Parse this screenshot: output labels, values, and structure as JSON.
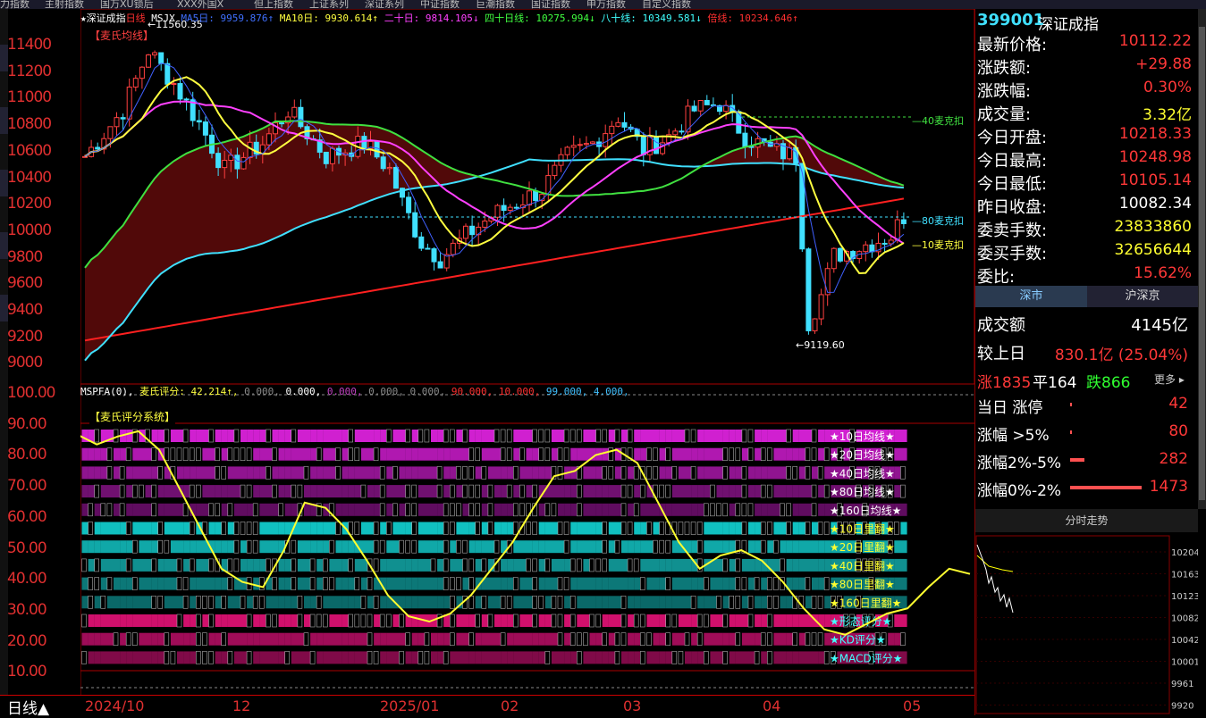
{
  "top_tabs": [
    "力指数",
    "主射指数",
    "国万XU锁后",
    "XXX外国X",
    "但上指数",
    "上证系列",
    "深证系列",
    "中证指数",
    "巨潮指数",
    "国证指数",
    "申万指数",
    "自定义指数"
  ],
  "chart": {
    "title": "深证成指",
    "period_label": "日线",
    "ma_legend": [
      {
        "label": "MSJX",
        "value": "",
        "color": "#fff"
      },
      {
        "label": "MA5日: 9959.876↑",
        "color": "#4070ff"
      },
      {
        "label": "MA10日: 9930.614↑",
        "color": "#ffff40"
      },
      {
        "label": "二十日: 9814.105↓",
        "color": "#ff40ff"
      },
      {
        "label": "四十日线: 10275.994↓",
        "color": "#40ff40"
      },
      {
        "label": "八十线: 10349.581↓",
        "color": "#40ffff"
      },
      {
        "label": "倍线: 10234.646↑",
        "color": "#ff3030"
      }
    ],
    "maishi_label": "【麦氏均线】",
    "high_annotation": "11560.35",
    "low_annotation": "9119.60",
    "line_labels": {
      "l40": "40麦克扣",
      "l80": "80麦克扣",
      "l10": "10麦克扣"
    },
    "y_ticks": [
      "11400",
      "11200",
      "11000",
      "10800",
      "10600",
      "10400",
      "10200",
      "10000",
      "9800",
      "9600",
      "9400",
      "9200",
      "9000"
    ],
    "x_dates": [
      "2024/10",
      "12",
      "2025/01",
      "02",
      "03",
      "04",
      "05"
    ]
  },
  "score_panel": {
    "legend": [
      {
        "label": "MSPFA(0)",
        "color": "#fff"
      },
      {
        "label": "麦氏评分: 42.214↑",
        "color": "#ffff40"
      },
      {
        "label": "0.000",
        "color": "#888"
      },
      {
        "label": "0.000",
        "color": "#fff"
      },
      {
        "label": "0.000",
        "color": "#c040c0"
      },
      {
        "label": "0.000",
        "color": "#888"
      },
      {
        "label": "0.000",
        "color": "#888"
      },
      {
        "label": "90.000",
        "color": "#ff3030"
      },
      {
        "label": "10.000",
        "color": "#ff3030"
      },
      {
        "label": "99.000",
        "color": "#40c0ff"
      },
      {
        "label": "4.000",
        "color": "#40c0ff"
      }
    ],
    "system_label": "【麦氏评分系统】",
    "y_ticks": [
      "100.00",
      "90.00",
      "80.00",
      "70.00",
      "60.00",
      "50.00",
      "40.00",
      "30.00",
      "20.00",
      "10.00"
    ],
    "rows": [
      {
        "label": "★10日均线★",
        "color": "#d020d0",
        "text": "#fff"
      },
      {
        "label": "★20日均线★",
        "color": "#b018b0",
        "text": "#fff"
      },
      {
        "label": "★40日均线★",
        "color": "#901490",
        "text": "#fff"
      },
      {
        "label": "★80日均线★",
        "color": "#701070",
        "text": "#fff"
      },
      {
        "label": "★160日均线★",
        "color": "#600c60",
        "text": "#fff"
      },
      {
        "label": "★10日里翻★",
        "color": "#10c0c0",
        "text": "#ffff30"
      },
      {
        "label": "★20日里翻★",
        "color": "#10a8a8",
        "text": "#ffff30"
      },
      {
        "label": "★40日里翻★",
        "color": "#109090",
        "text": "#ffff30"
      },
      {
        "label": "★80日里翻★",
        "color": "#0c7878",
        "text": "#ffff30"
      },
      {
        "label": "★160日里翻★",
        "color": "#0a6868",
        "text": "#ffff30"
      },
      {
        "label": "★形态评分★",
        "color": "#d0106c",
        "text": "#40ffff"
      },
      {
        "label": "★KD评分★",
        "color": "#a00c58",
        "text": "#40ffff"
      },
      {
        "label": "★MACD评分★",
        "color": "#800a48",
        "text": "#40ffff"
      }
    ]
  },
  "quote": {
    "code": "399001",
    "name": "深证成指",
    "rows": [
      {
        "label": "最新价格:",
        "value": "10112.22",
        "cls": "red"
      },
      {
        "label": "涨跌额:",
        "value": "+29.88",
        "cls": "red"
      },
      {
        "label": "涨跌幅:",
        "value": "0.30%",
        "cls": "red"
      },
      {
        "label": "成交量:",
        "value": "3.32亿",
        "cls": "yel"
      },
      {
        "label": "今日开盘:",
        "value": "10218.33",
        "cls": "red"
      },
      {
        "label": "今日最高:",
        "value": "10248.98",
        "cls": "red"
      },
      {
        "label": "今日最低:",
        "value": "10105.14",
        "cls": "red"
      },
      {
        "label": "昨日收盘:",
        "value": "10082.34",
        "cls": "wht"
      },
      {
        "label": "委卖手数:",
        "value": "23833860",
        "cls": "yel"
      },
      {
        "label": "委买手数:",
        "value": "32656644",
        "cls": "yel"
      },
      {
        "label": "委比:",
        "value": "15.62%",
        "cls": "red"
      }
    ],
    "tabs": [
      "深市",
      "沪深京"
    ],
    "turnover_label": "成交额",
    "turnover_value": "4145亿",
    "vs_label": "较上日",
    "vs_value": "830.1亿 (25.04%)",
    "up": "涨1835",
    "flat": "平164",
    "down": "跌866",
    "more": "更多",
    "breadth": [
      {
        "label": "当日 涨停",
        "value": "42",
        "bar": 0.01
      },
      {
        "label": "涨幅 >5%",
        "value": "80",
        "bar": 0.01
      },
      {
        "label": "涨幅2%-5%",
        "value": "282",
        "bar": 0.2
      },
      {
        "label": "涨幅0%-2%",
        "value": "1473",
        "bar": 1.0
      }
    ],
    "mini_title": "分时走势",
    "mini_ticks": [
      "10204",
      "10163",
      "10123",
      "10082",
      "10042",
      "10001",
      "9961",
      "9920"
    ]
  }
}
